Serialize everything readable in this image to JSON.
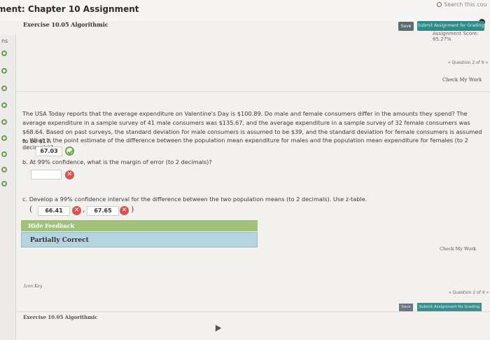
{
  "header": {
    "title": "ment: Chapter 10 Assignment",
    "search_text": "Search this cou"
  },
  "nav": {
    "label": "ns"
  },
  "exercise": {
    "title": "Exercise 10.05 Algorithmic",
    "score": "Assignment Score: 85.27%",
    "save_label": "Save",
    "submit_label": "Submit Assignment for Grading",
    "question_nav": "« Question 2 of 9 »",
    "check_work": "Check My Work"
  },
  "question": {
    "text": "The USA Today reports that the average expenditure on Valentine's Day is $100.89. Do male and female consumers differ in the amounts they spend? The average expenditure in a sample survey of 41 male consumers was $135.67, and the average expenditure in a sample survey of 32 female consumers was $68.64. Based on past surveys, the standard deviation for male consumers is assumed to be $39, and the standard deviation for female consumers is assumed to be $17.",
    "part_a": "a. What is the point estimate of the difference between the population mean expenditure for males and the population mean expenditure for females (to 2 decimals)?",
    "answer_a": "67.03",
    "part_b": "b. At 99% confidence, what is the margin of error (to 2 decimals)?",
    "answer_b": "",
    "part_c": "c. Develop a 99% confidence interval for the difference between the two population means (to 2 decimals). Use z-table.",
    "answer_c_low": "66.41",
    "answer_c_high": "67.65",
    "paren_open": "(",
    "paren_close": ")",
    "comma": ","
  },
  "feedback": {
    "hide_label": "Hide Feedback",
    "status": "Partially Correct"
  },
  "footer": {
    "check_work": "Check My Work",
    "key_link": "Icon Key",
    "question_nav": "« Question 2 of 9 »",
    "save_label": "Save",
    "submit_label": "Submit Assignment for Grading",
    "exercise_title": "Exercise 10.05 Algorithmic"
  },
  "colors": {
    "correct": "#6aa64a",
    "incorrect": "#d9534f",
    "submit": "#2f8a8a",
    "feedback_bar": "#9ec27a",
    "partial_box": "#b4d4df"
  }
}
